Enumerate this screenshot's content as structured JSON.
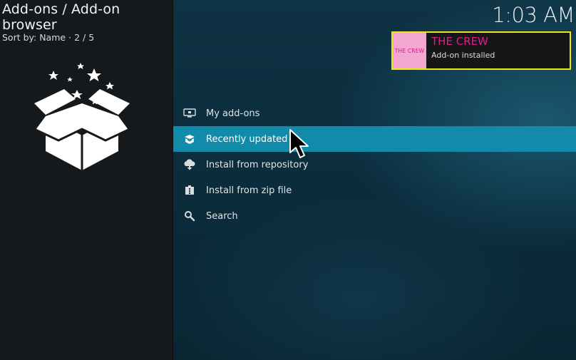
{
  "header": {
    "title": "Add-ons / Add-on browser",
    "sort_label": "Sort by: Name",
    "separator": "·",
    "position": "2 / 5"
  },
  "clock": "1:03 AM",
  "notification": {
    "thumb_text": "THE CREW",
    "title": "THE CREW",
    "message": "Add-on installed",
    "colors": {
      "border": "#f2e516",
      "title": "#e21b89",
      "thumb_bg": "#f3a6cf"
    }
  },
  "menu": {
    "items": [
      {
        "label": "My add-ons",
        "icon": "monitor-icon"
      },
      {
        "label": "Recently updated",
        "icon": "updated-box-icon"
      },
      {
        "label": "Install from repository",
        "icon": "cloud-download-icon"
      },
      {
        "label": "Install from zip file",
        "icon": "zip-file-icon"
      },
      {
        "label": "Search",
        "icon": "search-icon"
      }
    ],
    "selected_index": 1,
    "colors": {
      "selected_bg": "#128aa9"
    }
  },
  "left_icon": "open-box-stars-icon"
}
